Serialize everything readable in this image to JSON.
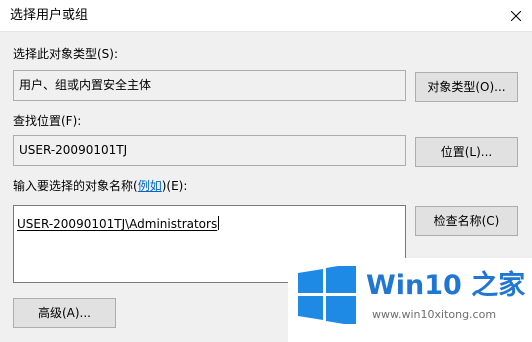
{
  "window": {
    "title": "选择用户或组"
  },
  "object_type": {
    "label": "选择此对象类型(S):",
    "value": "用户、组或内置安全主体",
    "button_label": "对象类型(O)..."
  },
  "location": {
    "label": "查找位置(F):",
    "value": "USER-20090101TJ",
    "button_label": "位置(L)..."
  },
  "object_names": {
    "label_prefix": "输入要选择的对象名称(",
    "label_link": "例如",
    "label_suffix": ")(E):",
    "value": "USER-20090101TJ\\Administrators",
    "check_button_label": "检查名称(C)"
  },
  "advanced_button_label": "高级(A)...",
  "watermark": {
    "brand": "Win10 之家",
    "url": "www.win10xitong.com",
    "colors": {
      "brand": "#1f77d3",
      "logo": "#1f8ae6"
    }
  }
}
